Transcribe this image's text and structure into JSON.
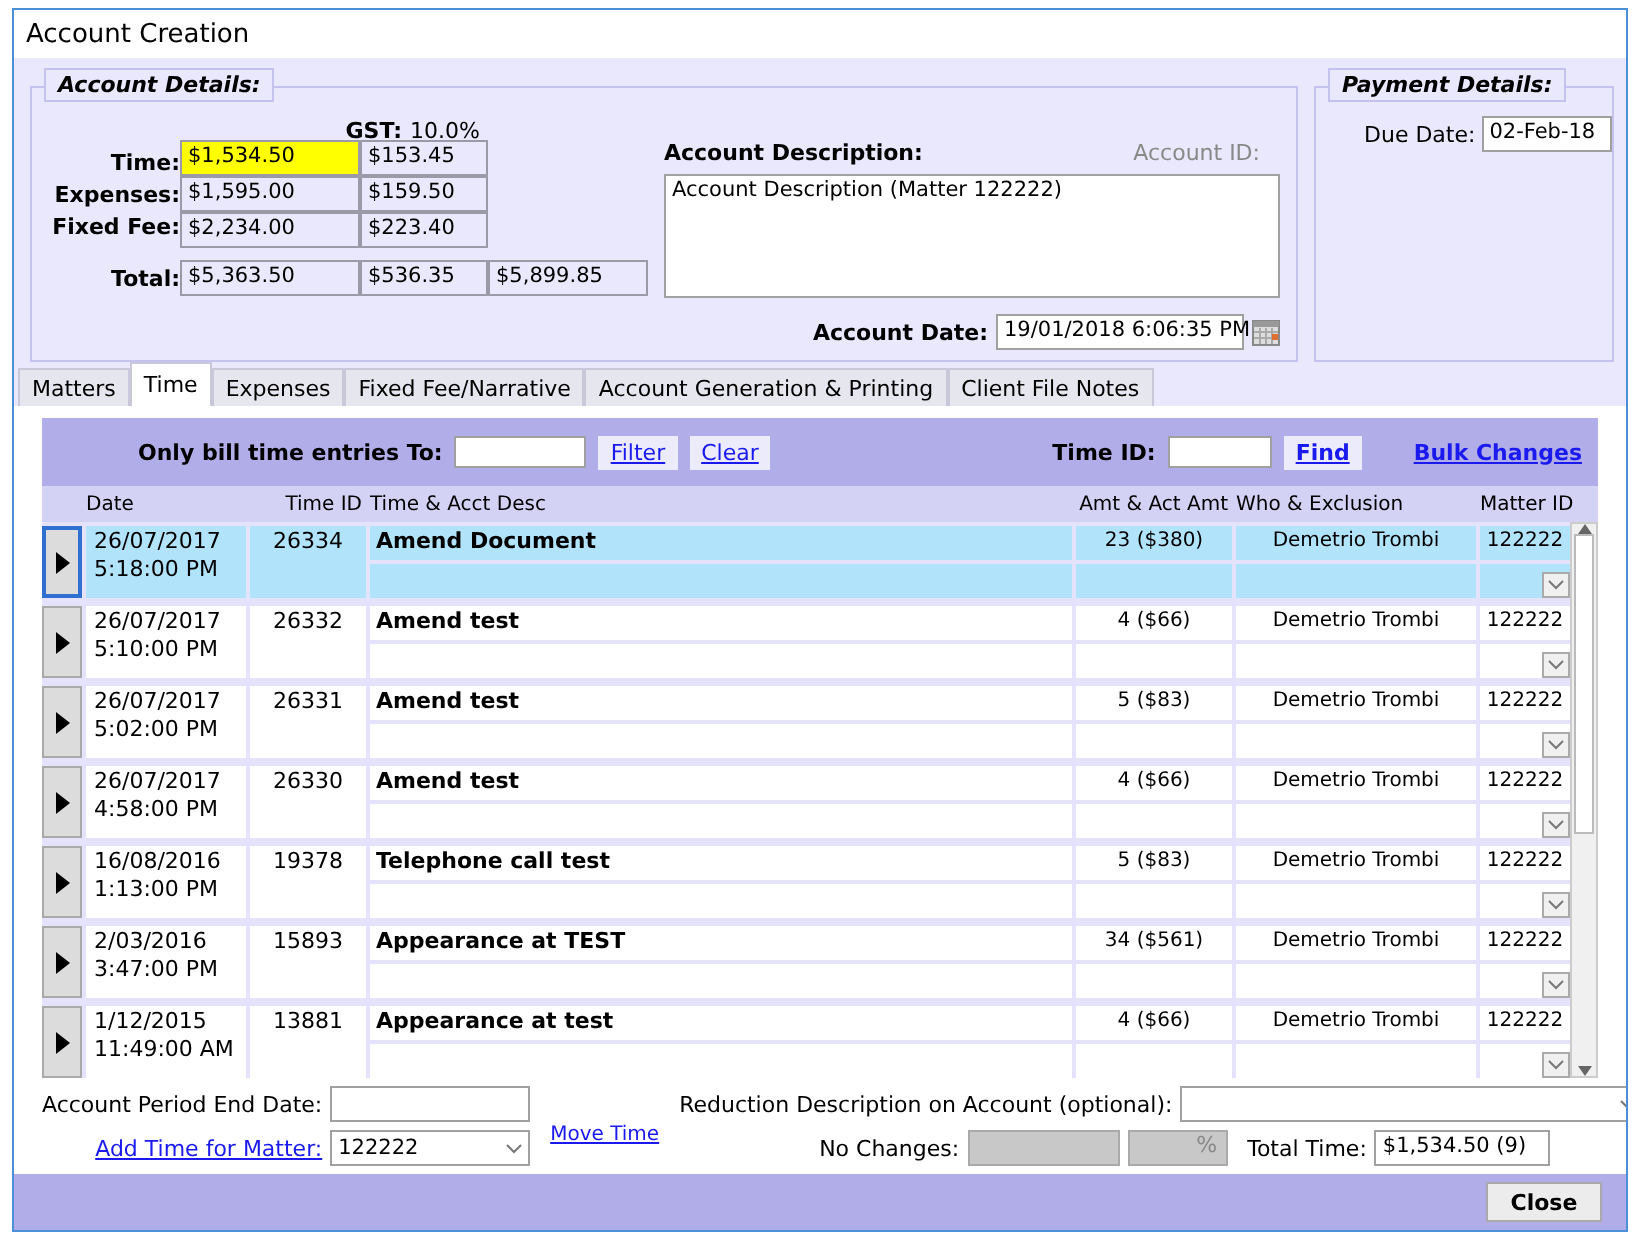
{
  "window": {
    "title": "Account Creation"
  },
  "account_details": {
    "legend": "Account Details:",
    "gst_label": "GST:",
    "gst_rate": "10.0%",
    "lines": [
      {
        "label": "Time:",
        "amount": "$1,534.50",
        "gst": "$153.45",
        "highlighted": true
      },
      {
        "label": "Expenses:",
        "amount": "$1,595.00",
        "gst": "$159.50",
        "highlighted": false
      },
      {
        "label": "Fixed Fee:",
        "amount": "$2,234.00",
        "gst": "$223.40",
        "highlighted": false
      }
    ],
    "total": {
      "label": "Total:",
      "amount": "$5,363.50",
      "gst": "$536.35",
      "grand": "$5,899.85"
    },
    "description_label": "Account Description:",
    "description": "Account Description (Matter 122222)",
    "account_id_label": "Account ID:",
    "account_date_label": "Account Date:",
    "account_date": "19/01/2018 6:06:35 PM"
  },
  "payment_details": {
    "legend": "Payment Details:",
    "due_date_label": "Due Date:",
    "due_date": "02-Feb-18"
  },
  "tabs": [
    {
      "label": "Matters",
      "selected": false
    },
    {
      "label": "Time",
      "selected": true
    },
    {
      "label": "Expenses",
      "selected": false
    },
    {
      "label": "Fixed Fee/Narrative",
      "selected": false
    },
    {
      "label": "Account Generation & Printing",
      "selected": false
    },
    {
      "label": "Client File Notes",
      "selected": false
    }
  ],
  "filter": {
    "label": "Only bill time entries To:",
    "filter_link": "Filter",
    "clear_link": "Clear",
    "time_id_label": "Time ID:",
    "find_link": "Find",
    "bulk_link": "Bulk Changes"
  },
  "table": {
    "columns": [
      "Date",
      "Time ID",
      "Time & Acct Desc",
      "Amt & Act Amt",
      "Who & Exclusion",
      "Matter ID"
    ],
    "rows": [
      {
        "date": "26/07/2017",
        "time": "5:18:00 PM",
        "id": "26334",
        "desc": "Amend Document",
        "amount": "23 ($380)",
        "who": "Demetrio Trombi",
        "matter": "122222",
        "selected": true
      },
      {
        "date": "26/07/2017",
        "time": "5:10:00 PM",
        "id": "26332",
        "desc": "Amend test",
        "amount": "4 ($66)",
        "who": "Demetrio Trombi",
        "matter": "122222",
        "selected": false
      },
      {
        "date": "26/07/2017",
        "time": "5:02:00 PM",
        "id": "26331",
        "desc": "Amend test",
        "amount": "5 ($83)",
        "who": "Demetrio Trombi",
        "matter": "122222",
        "selected": false
      },
      {
        "date": "26/07/2017",
        "time": "4:58:00 PM",
        "id": "26330",
        "desc": "Amend test",
        "amount": "4 ($66)",
        "who": "Demetrio Trombi",
        "matter": "122222",
        "selected": false
      },
      {
        "date": "16/08/2016",
        "time": "1:13:00 PM",
        "id": "19378",
        "desc": "Telephone call test",
        "amount": "5 ($83)",
        "who": "Demetrio Trombi",
        "matter": "122222",
        "selected": false
      },
      {
        "date": "2/03/2016",
        "time": "3:47:00 PM",
        "id": "15893",
        "desc": "Appearance at TEST",
        "amount": "34 ($561)",
        "who": "Demetrio Trombi",
        "matter": "122222",
        "selected": false
      },
      {
        "date": "1/12/2015",
        "time": "11:49:00 AM",
        "id": "13881",
        "desc": "Appearance at test",
        "amount": "4 ($66)",
        "who": "Demetrio Trombi",
        "matter": "122222",
        "selected": false
      }
    ]
  },
  "footer": {
    "period_end_label": "Account Period End Date:",
    "add_time_link": "Add Time for Matter:",
    "add_time_matter": "122222",
    "move_time_link": "Move Time",
    "reduction_label": "Reduction Description on Account (optional):",
    "no_changes_label": "No Changes:",
    "percent": "%",
    "total_time_label": "Total Time:",
    "total_time": "$1,534.50 (9)"
  },
  "buttons": {
    "close": "Close"
  }
}
